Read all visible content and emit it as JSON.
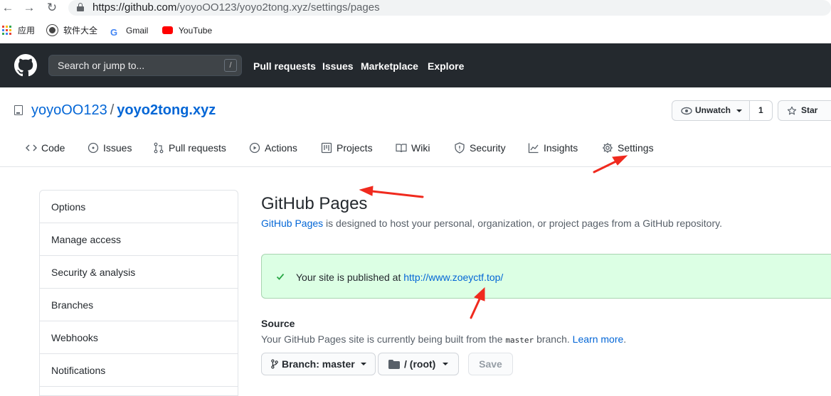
{
  "browser": {
    "url_host": "https://github.com",
    "url_path": "/yoyoOO123/yoyo2tong.xyz/settings/pages",
    "bookmarks": [
      "应用",
      "软件大全",
      "Gmail",
      "YouTube"
    ]
  },
  "header": {
    "search_placeholder": "Search or jump to...",
    "search_key": "/",
    "nav": [
      "Pull requests",
      "Issues",
      "Marketplace",
      "Explore"
    ]
  },
  "repo": {
    "owner": "yoyoOO123",
    "separator": "/",
    "name": "yoyo2tong.xyz",
    "unwatch_label": "Unwatch",
    "watch_count": "1",
    "star_label": "Star"
  },
  "tabs": [
    "Code",
    "Issues",
    "Pull requests",
    "Actions",
    "Projects",
    "Wiki",
    "Security",
    "Insights",
    "Settings"
  ],
  "sidebar": {
    "items": [
      "Options",
      "Manage access",
      "Security & analysis",
      "Branches",
      "Webhooks",
      "Notifications"
    ]
  },
  "main": {
    "title": "GitHub Pages",
    "desc_link": "GitHub Pages",
    "desc_rest": " is designed to host your personal, organization, or project pages from a GitHub repository.",
    "flash_text": "Your site is published at ",
    "flash_url": "http://www.zoeyctf.top/",
    "source_heading": "Source",
    "source_pre": "Your GitHub Pages site is currently being built from the ",
    "source_branch": "master",
    "source_mid": " branch. ",
    "source_learn": "Learn more",
    "source_end": ".",
    "branch_select": "Branch: master",
    "folder_select": "/ (root)",
    "save_label": "Save"
  },
  "colors": {
    "header_bg": "#24292e",
    "link": "#0366d6",
    "flash_bg": "#dcffe4",
    "annotation_arrow": "#f02a1e"
  }
}
